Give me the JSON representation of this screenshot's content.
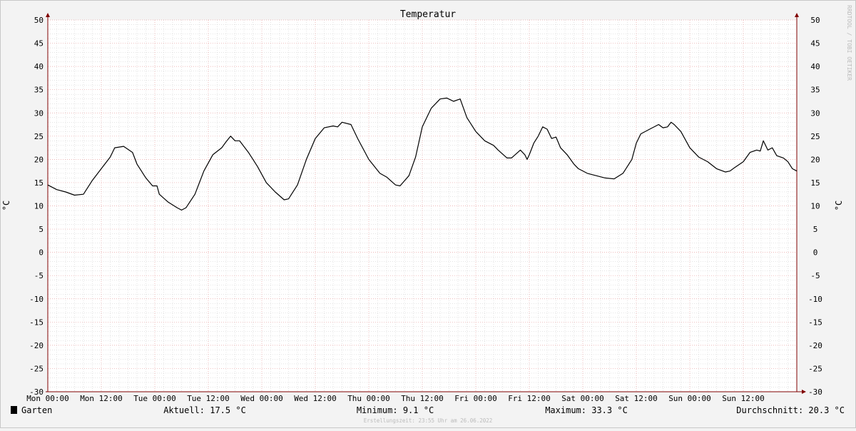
{
  "chart_data": {
    "type": "line",
    "title": "Temperatur",
    "ylabel": "°C",
    "ylabel_right": "°C",
    "ylim": [
      -30,
      50
    ],
    "y_ticks": [
      50,
      45,
      40,
      35,
      30,
      25,
      20,
      15,
      10,
      5,
      0,
      -5,
      -10,
      -15,
      -20,
      -25,
      -30
    ],
    "x_range_hours": [
      0,
      168
    ],
    "x_ticks": [
      {
        "hour": 0,
        "label": "Mon 00:00"
      },
      {
        "hour": 12,
        "label": "Mon 12:00"
      },
      {
        "hour": 24,
        "label": "Tue 00:00"
      },
      {
        "hour": 36,
        "label": "Tue 12:00"
      },
      {
        "hour": 48,
        "label": "Wed 00:00"
      },
      {
        "hour": 60,
        "label": "Wed 12:00"
      },
      {
        "hour": 72,
        "label": "Thu 00:00"
      },
      {
        "hour": 84,
        "label": "Thu 12:00"
      },
      {
        "hour": 96,
        "label": "Fri 00:00"
      },
      {
        "hour": 108,
        "label": "Fri 12:00"
      },
      {
        "hour": 120,
        "label": "Sat 00:00"
      },
      {
        "hour": 132,
        "label": "Sat 12:00"
      },
      {
        "hour": 144,
        "label": "Sun 00:00"
      },
      {
        "hour": 156,
        "label": "Sun 12:00"
      }
    ],
    "grid": true,
    "series": [
      {
        "name": "Garten",
        "color": "#000000",
        "points": [
          [
            0,
            14.5
          ],
          [
            2,
            13.5
          ],
          [
            4,
            13.0
          ],
          [
            6,
            12.3
          ],
          [
            8,
            12.5
          ],
          [
            10,
            15.5
          ],
          [
            12,
            18.0
          ],
          [
            14,
            20.5
          ],
          [
            15,
            22.5
          ],
          [
            17,
            22.8
          ],
          [
            19,
            21.5
          ],
          [
            20,
            19.0
          ],
          [
            22,
            16.0
          ],
          [
            23.5,
            14.3
          ],
          [
            24.5,
            14.3
          ],
          [
            25,
            12.5
          ],
          [
            27,
            10.8
          ],
          [
            29,
            9.6
          ],
          [
            30,
            9.1
          ],
          [
            31,
            9.6
          ],
          [
            33,
            12.5
          ],
          [
            35,
            17.5
          ],
          [
            37,
            21.0
          ],
          [
            39,
            22.5
          ],
          [
            40,
            23.8
          ],
          [
            41,
            25.0
          ],
          [
            42,
            24.0
          ],
          [
            43,
            24.0
          ],
          [
            45,
            21.5
          ],
          [
            47,
            18.5
          ],
          [
            49,
            15.0
          ],
          [
            51,
            13.0
          ],
          [
            53,
            11.3
          ],
          [
            54,
            11.5
          ],
          [
            56,
            14.5
          ],
          [
            58,
            20.0
          ],
          [
            60,
            24.5
          ],
          [
            62,
            26.8
          ],
          [
            64,
            27.2
          ],
          [
            65,
            27.0
          ],
          [
            66,
            28.0
          ],
          [
            68,
            27.5
          ],
          [
            69.5,
            24.5
          ],
          [
            72,
            20.0
          ],
          [
            74.5,
            17.0
          ],
          [
            76,
            16.2
          ],
          [
            78,
            14.5
          ],
          [
            79,
            14.3
          ],
          [
            81,
            16.5
          ],
          [
            82.5,
            20.5
          ],
          [
            84,
            27.0
          ],
          [
            86,
            31.0
          ],
          [
            88,
            33.0
          ],
          [
            89.5,
            33.2
          ],
          [
            91,
            32.5
          ],
          [
            92.5,
            33.0
          ],
          [
            94,
            29.0
          ],
          [
            96,
            26.0
          ],
          [
            98,
            24.0
          ],
          [
            100,
            23.0
          ],
          [
            101,
            22.0
          ],
          [
            103,
            20.3
          ],
          [
            104,
            20.3
          ],
          [
            106,
            22.0
          ],
          [
            107,
            21.0
          ],
          [
            107.5,
            20.0
          ],
          [
            108,
            21.0
          ],
          [
            109,
            23.5
          ],
          [
            110,
            25.0
          ],
          [
            111,
            27.0
          ],
          [
            112,
            26.5
          ],
          [
            113,
            24.5
          ],
          [
            114,
            24.8
          ],
          [
            115,
            22.5
          ],
          [
            116.5,
            21.0
          ],
          [
            118,
            19.0
          ],
          [
            119,
            18.0
          ],
          [
            121,
            17.0
          ],
          [
            123,
            16.5
          ],
          [
            125,
            16.0
          ],
          [
            127,
            15.8
          ],
          [
            129,
            17.0
          ],
          [
            131,
            20.0
          ],
          [
            132,
            23.5
          ],
          [
            133,
            25.5
          ],
          [
            135,
            26.5
          ],
          [
            137,
            27.5
          ],
          [
            138,
            26.8
          ],
          [
            139,
            27.0
          ],
          [
            139.8,
            28.0
          ],
          [
            140.5,
            27.5
          ],
          [
            142,
            26.0
          ],
          [
            144,
            22.5
          ],
          [
            146,
            20.5
          ],
          [
            148,
            19.5
          ],
          [
            150,
            18.0
          ],
          [
            152,
            17.3
          ],
          [
            153,
            17.5
          ],
          [
            154,
            18.2
          ],
          [
            156,
            19.5
          ],
          [
            157.5,
            21.5
          ],
          [
            159,
            22.0
          ],
          [
            159.8,
            21.8
          ],
          [
            160.5,
            24.0
          ],
          [
            161.5,
            22.0
          ],
          [
            162.5,
            22.5
          ],
          [
            163.5,
            20.8
          ],
          [
            165,
            20.3
          ],
          [
            166,
            19.5
          ],
          [
            167,
            18.0
          ],
          [
            168,
            17.5
          ]
        ]
      }
    ]
  },
  "legend": {
    "series_label": "Garten",
    "swatch_color": "#000000",
    "current": "Aktuell: 17.5 °C",
    "minimum": "Minimum: 9.1 °C",
    "maximum": "Maximum: 33.3 °C",
    "average": "Durchschnitt: 20.3 °C"
  },
  "footer": {
    "created": "Erstellungszeit: 23:55 Uhr am 26.06.2022"
  },
  "watermark": "RRDTOOL / TOBI OETIKER",
  "colors": {
    "background": "#f3f3f3",
    "canvas": "#ffffff",
    "major_grid": "#e8a0a0",
    "minor_grid": "#c8c8c8",
    "axis": "#800000",
    "line": "#000000"
  }
}
